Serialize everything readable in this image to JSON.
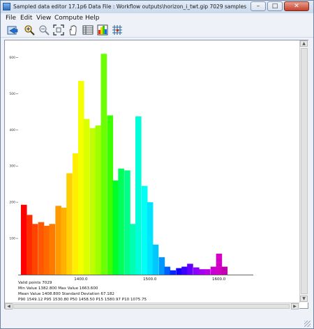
{
  "window": {
    "title": "Sampled data editor 17.1p6 Data File : Workflow outputs\\horizon_i_twt.gip 7029 samples",
    "buttons": {
      "minimize": "–",
      "maximize": "□",
      "close": "✕"
    }
  },
  "menu": [
    "File",
    "Edit",
    "View",
    "Compute",
    "Help"
  ],
  "toolbar": {
    "tools": [
      "open-icon",
      "zoom-in-icon",
      "zoom-out-icon",
      "fit-extents-icon",
      "pan-hand-icon",
      "table-view-icon",
      "histogram-icon",
      "grid-icon"
    ]
  },
  "chart_data": {
    "type": "bar",
    "title": "",
    "xlabel": "",
    "ylabel": "",
    "x_ticks": [
      "1400.0",
      "1500.0",
      "1600.0"
    ],
    "y_ticks": [
      "100",
      "200",
      "300",
      "400",
      "500",
      "600"
    ],
    "xlim": [
      1309,
      1650
    ],
    "ylim": [
      0,
      620
    ],
    "bin_width": 8.3,
    "bins": [
      {
        "x": 1313,
        "count": 193,
        "color": "#ff0000"
      },
      {
        "x": 1321,
        "count": 165,
        "color": "#ff2a00"
      },
      {
        "x": 1329,
        "count": 140,
        "color": "#ff4400"
      },
      {
        "x": 1338,
        "count": 145,
        "color": "#ff5800"
      },
      {
        "x": 1346,
        "count": 135,
        "color": "#ff6800"
      },
      {
        "x": 1354,
        "count": 140,
        "color": "#ff7a00"
      },
      {
        "x": 1363,
        "count": 190,
        "color": "#ff9900"
      },
      {
        "x": 1371,
        "count": 185,
        "color": "#ffb000"
      },
      {
        "x": 1379,
        "count": 280,
        "color": "#ffd000"
      },
      {
        "x": 1388,
        "count": 335,
        "color": "#ffee00"
      },
      {
        "x": 1396,
        "count": 535,
        "color": "#f4ff00"
      },
      {
        "x": 1404,
        "count": 430,
        "color": "#dcff00"
      },
      {
        "x": 1413,
        "count": 405,
        "color": "#c0ff00"
      },
      {
        "x": 1421,
        "count": 412,
        "color": "#a0ff00"
      },
      {
        "x": 1429,
        "count": 610,
        "color": "#6cff00"
      },
      {
        "x": 1438,
        "count": 440,
        "color": "#3cff00"
      },
      {
        "x": 1446,
        "count": 260,
        "color": "#00ff26"
      },
      {
        "x": 1454,
        "count": 293,
        "color": "#00ff5a"
      },
      {
        "x": 1463,
        "count": 288,
        "color": "#00ff88"
      },
      {
        "x": 1471,
        "count": 140,
        "color": "#00ffb0"
      },
      {
        "x": 1479,
        "count": 437,
        "color": "#00ffd8"
      },
      {
        "x": 1488,
        "count": 245,
        "color": "#00fff5"
      },
      {
        "x": 1496,
        "count": 200,
        "color": "#00e5ff"
      },
      {
        "x": 1504,
        "count": 83,
        "color": "#00c8ff"
      },
      {
        "x": 1513,
        "count": 48,
        "color": "#0098ff"
      },
      {
        "x": 1521,
        "count": 22,
        "color": "#0060ff"
      },
      {
        "x": 1529,
        "count": 12,
        "color": "#0028ff"
      },
      {
        "x": 1538,
        "count": 18,
        "color": "#1400ff"
      },
      {
        "x": 1546,
        "count": 22,
        "color": "#3c00ff"
      },
      {
        "x": 1554,
        "count": 30,
        "color": "#6400ff"
      },
      {
        "x": 1563,
        "count": 20,
        "color": "#8c00ff"
      },
      {
        "x": 1571,
        "count": 15,
        "color": "#a400f2"
      },
      {
        "x": 1579,
        "count": 15,
        "color": "#b800e4"
      },
      {
        "x": 1588,
        "count": 22,
        "color": "#c800d4"
      },
      {
        "x": 1596,
        "count": 58,
        "color": "#d200c4"
      },
      {
        "x": 1604,
        "count": 22,
        "color": "#c000b0"
      }
    ]
  },
  "stats": {
    "line1": "Valid points 7029",
    "line2": "Min Value 1382.800   Max Value 1663.600",
    "line3": "Mean Value 1408.800   Standard Deviation 67.182",
    "line4": "P90 1549.12  P95 1530.80  P50 1458.50  P15 1580.97  P10 1075.75"
  }
}
